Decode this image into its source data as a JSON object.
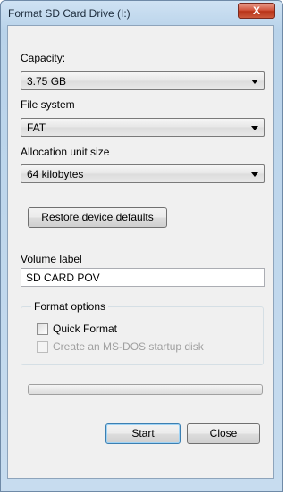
{
  "window": {
    "title": "Format SD Card Drive (I:)",
    "close_label": "X"
  },
  "capacity": {
    "label": "Capacity:",
    "value": "3.75 GB"
  },
  "file_system": {
    "label": "File system",
    "value": "FAT"
  },
  "allocation": {
    "label": "Allocation unit size",
    "value": "64 kilobytes"
  },
  "restore_button": {
    "label": "Restore device defaults"
  },
  "volume_label": {
    "label": "Volume label",
    "value": "SD CARD POV"
  },
  "format_options": {
    "title": "Format options",
    "quick_format": {
      "label": "Quick Format",
      "checked": false
    },
    "ms_dos": {
      "label": "Create an MS-DOS startup disk",
      "checked": false,
      "disabled": true
    }
  },
  "progress": {
    "fraction": 0
  },
  "buttons": {
    "start": "Start",
    "close": "Close"
  }
}
